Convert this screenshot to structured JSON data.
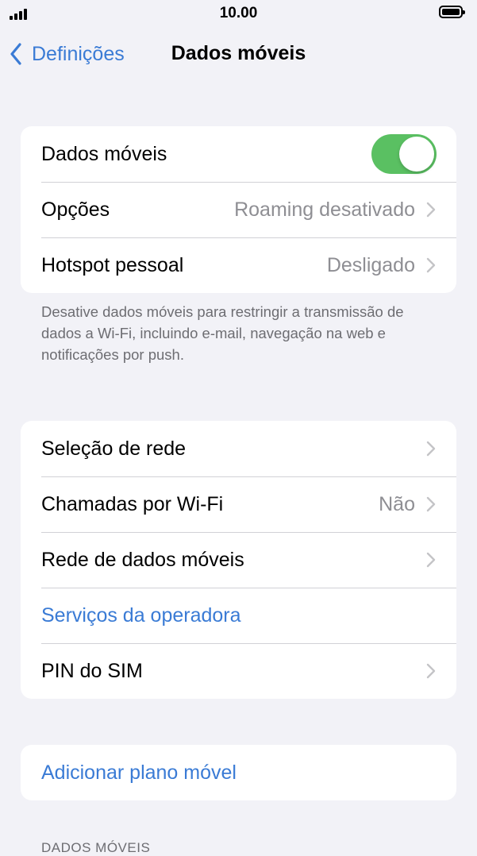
{
  "status": {
    "time": "10.00"
  },
  "nav": {
    "back_label": "Definições",
    "title": "Dados móveis"
  },
  "group1": {
    "mobile_data": {
      "label": "Dados móveis",
      "toggle_on": true
    },
    "options": {
      "label": "Opções",
      "value": "Roaming desativado"
    },
    "hotspot": {
      "label": "Hotspot pessoal",
      "value": "Desligado"
    }
  },
  "footer_note": "Desative dados móveis para restringir a transmissão de dados a Wi-Fi, incluindo e-mail, navegação na web e notificações por push.",
  "group2": {
    "network_selection": {
      "label": "Seleção de rede"
    },
    "wifi_calling": {
      "label": "Chamadas por Wi-Fi",
      "value": "Não"
    },
    "mobile_data_network": {
      "label": "Rede de dados móveis"
    },
    "carrier_services": {
      "label": "Serviços da operadora"
    },
    "sim_pin": {
      "label": "PIN do SIM"
    }
  },
  "group3": {
    "add_plan": {
      "label": "Adicionar plano móvel"
    }
  },
  "section_header": "DADOS MÓVEIS",
  "colors": {
    "accent": "#3a7bd5",
    "toggle_on": "#5ac062",
    "background": "#f2f2f7"
  }
}
